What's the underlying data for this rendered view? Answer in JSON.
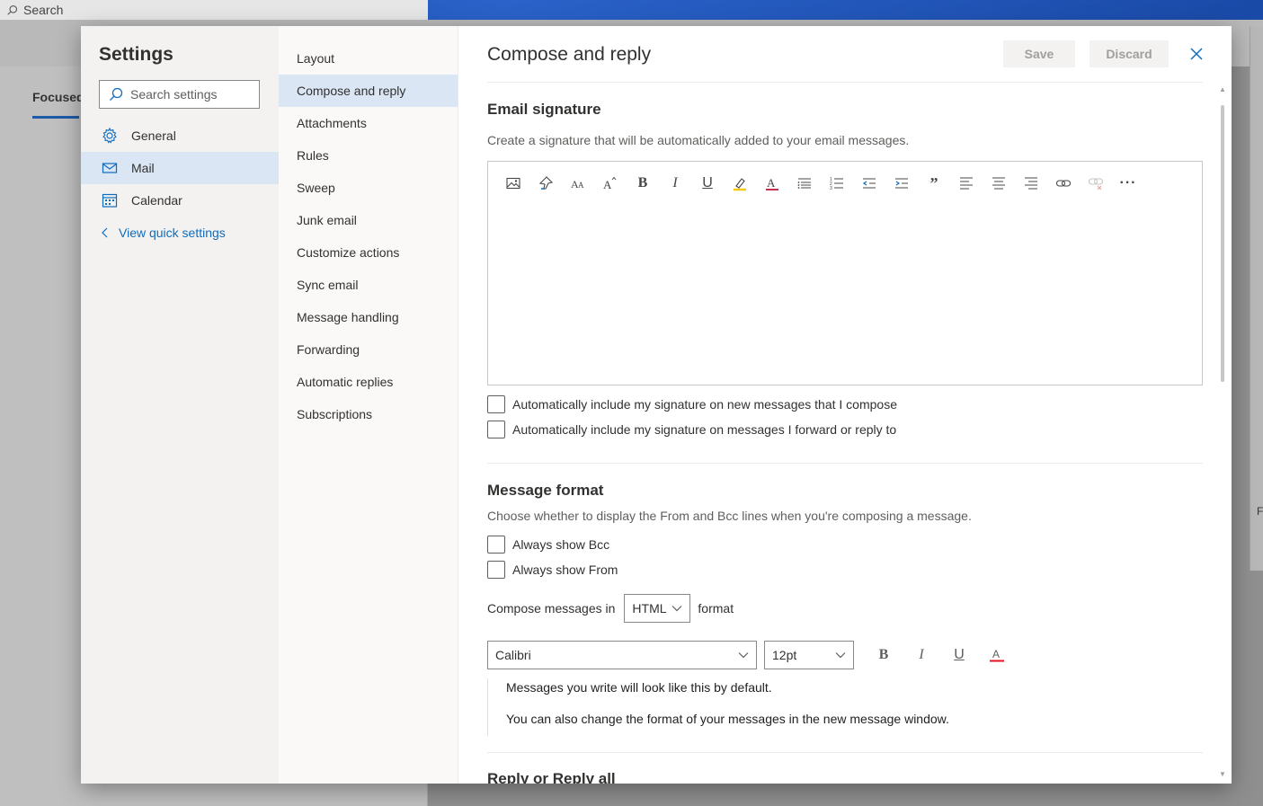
{
  "background": {
    "search_label": "Search",
    "focused_tab": "Focused",
    "right_letter": "F"
  },
  "settings": {
    "title": "Settings",
    "search_placeholder": "Search settings",
    "categories": [
      {
        "label": "General",
        "icon": "gear-icon"
      },
      {
        "label": "Mail",
        "icon": "mail-icon"
      },
      {
        "label": "Calendar",
        "icon": "calendar-icon"
      }
    ],
    "quick_settings": "View quick settings"
  },
  "mail_nav": {
    "items": [
      "Layout",
      "Compose and reply",
      "Attachments",
      "Rules",
      "Sweep",
      "Junk email",
      "Customize actions",
      "Sync email",
      "Message handling",
      "Forwarding",
      "Automatic replies",
      "Subscriptions"
    ],
    "selected": "Compose and reply"
  },
  "content": {
    "title": "Compose and reply",
    "save_label": "Save",
    "discard_label": "Discard",
    "signature": {
      "title": "Email signature",
      "description": "Create a signature that will be automatically added to your email messages.",
      "toolbar": [
        "insert-image-icon",
        "format-painter-icon",
        "font-size-icon",
        "grow-font-icon",
        "bold-icon",
        "italic-icon",
        "underline-icon",
        "highlight-icon",
        "font-color-icon",
        "bullets-icon",
        "numbering-icon",
        "decrease-indent-icon",
        "increase-indent-icon",
        "quote-icon",
        "align-left-icon",
        "align-center-icon",
        "align-right-icon",
        "insert-link-icon",
        "remove-link-icon",
        "more-options-icon"
      ],
      "check_new": "Automatically include my signature on new messages that I compose",
      "check_reply": "Automatically include my signature on messages I forward or reply to"
    },
    "message_format": {
      "title": "Message format",
      "description": "Choose whether to display the From and Bcc lines when you're composing a message.",
      "check_bcc": "Always show Bcc",
      "check_from": "Always show From",
      "compose_prefix": "Compose messages in",
      "compose_value": "HTML",
      "compose_suffix": "format",
      "font_family": "Calibri",
      "font_size": "12pt",
      "preview_line1": "Messages you write will look like this by default.",
      "preview_line2": "You can also change the format of your messages in the new message window."
    },
    "next_section": "Reply or Reply all"
  }
}
